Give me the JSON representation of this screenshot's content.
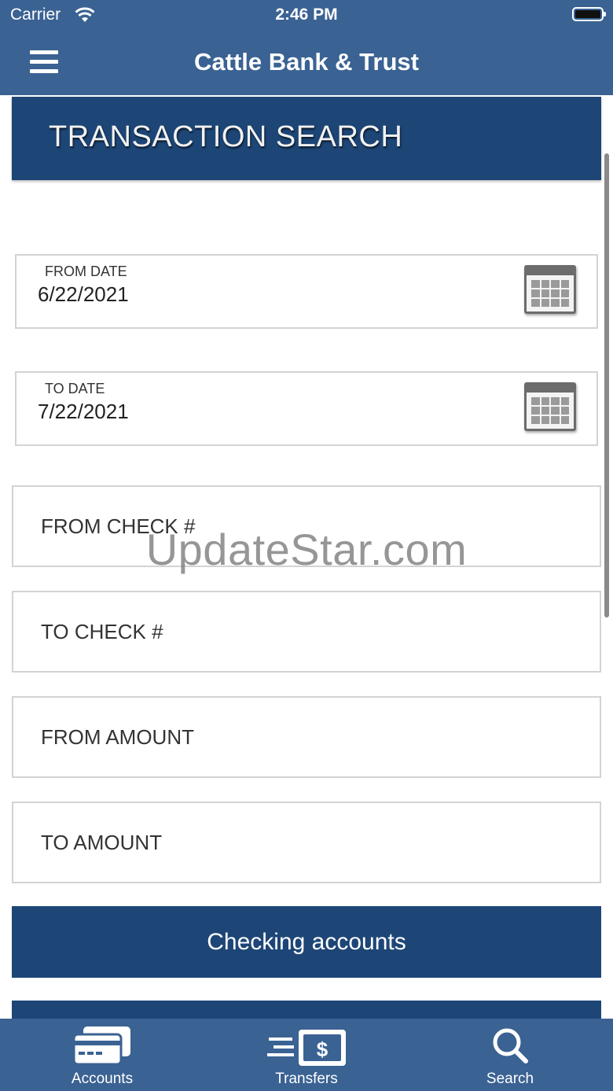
{
  "status_bar": {
    "carrier": "Carrier",
    "time": "2:46 PM"
  },
  "nav": {
    "title": "Cattle Bank & Trust"
  },
  "page": {
    "title": "TRANSACTION SEARCH"
  },
  "form": {
    "from_date": {
      "label": "FROM DATE",
      "value": "6/22/2021"
    },
    "to_date": {
      "label": "TO DATE",
      "value": "7/22/2021"
    },
    "from_check": {
      "placeholder": "FROM CHECK #"
    },
    "to_check": {
      "placeholder": "TO CHECK #"
    },
    "from_amount": {
      "placeholder": "FROM AMOUNT"
    },
    "to_amount": {
      "placeholder": "TO AMOUNT"
    },
    "account_button": "Checking accounts"
  },
  "watermark": "UpdateStar.com",
  "tabs": [
    {
      "label": "Accounts",
      "icon": "credit-card-icon"
    },
    {
      "label": "Transfers",
      "icon": "transfer-icon"
    },
    {
      "label": "Search",
      "icon": "search-icon"
    }
  ],
  "colors": {
    "bar": "#3a6293",
    "header": "#1d4677",
    "field_border": "#d3d3d3"
  }
}
